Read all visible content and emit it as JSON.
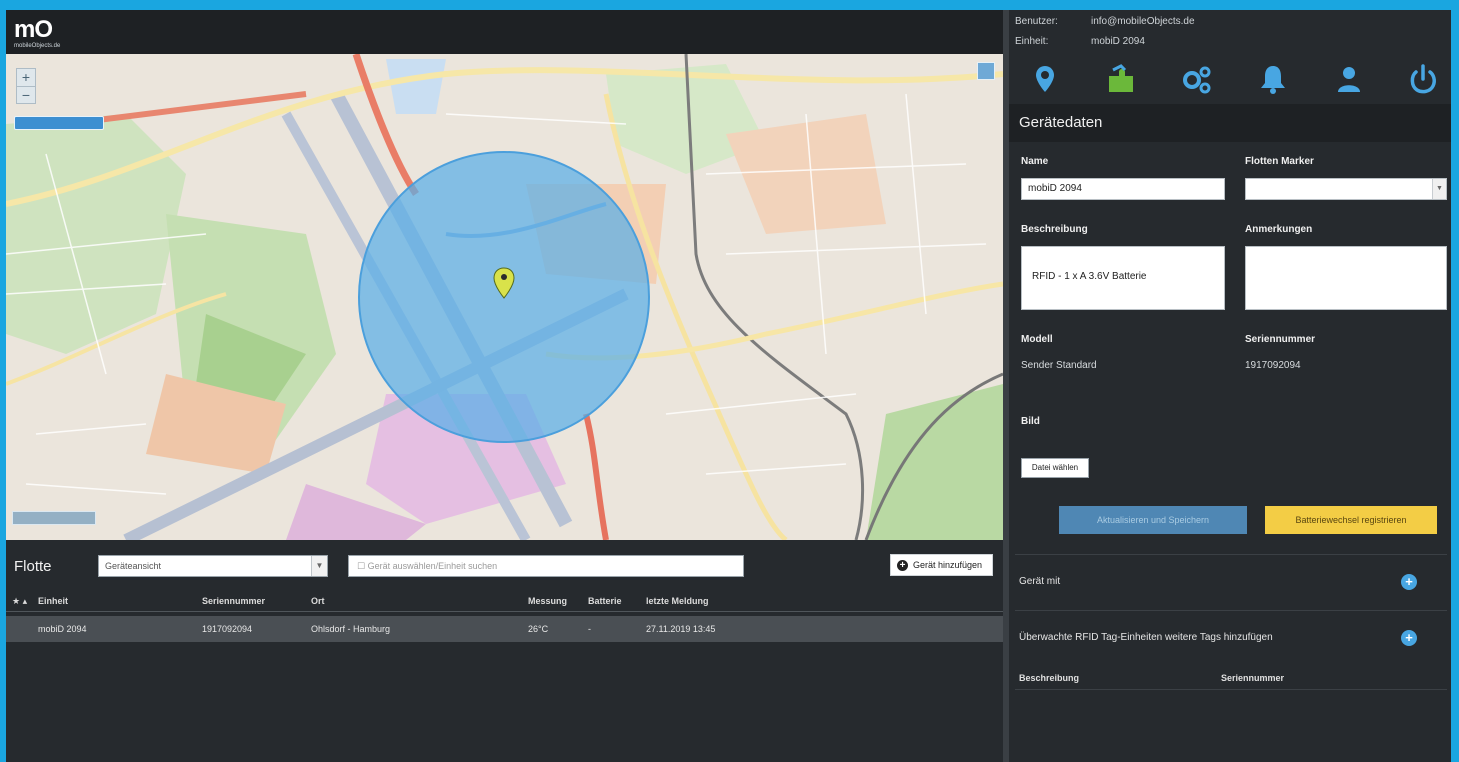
{
  "app": {
    "logo_text": "mO",
    "logo_tagline": "mobileObjects.de"
  },
  "user": {
    "benutzer_label": "Benutzer:",
    "benutzer_value": "info@mobileObjects.de",
    "einheit_label": "Einheit:",
    "einheit_value": "mobiD 2094"
  },
  "icons": [
    "map-pin-icon",
    "puzzle-icon",
    "settings-gears-icon",
    "bell-icon",
    "user-icon",
    "power-icon"
  ],
  "panel": {
    "header": "Gerätedaten",
    "name_label": "Name",
    "name_value": "mobiD 2094",
    "flotten_marker_label": "Flotten Marker",
    "flotten_marker_value": "",
    "beschreibung_label": "Beschreibung",
    "beschreibung_value": "RFID - 1 x A 3.6V Batterie",
    "anmerkungen_label": "Anmerkungen",
    "anmerkungen_value": "",
    "modell_label": "Modell",
    "modell_value": "Sender Standard",
    "seriennummer_label": "Seriennummer",
    "seriennummer_value": "1917092094",
    "bild_label": "Bild",
    "upload_button": "Datei wählen",
    "blue_button": "Aktualisieren und Speichern",
    "yellow_button": "Batteriewechsel registrieren",
    "section1": "Gerät mit",
    "section2": "Überwachte RFID Tag-Einheiten weitere Tags hinzufügen",
    "col_beschreibung": "Beschreibung",
    "col_seriennummer": "Seriennummer"
  },
  "fleet": {
    "title": "Flotte",
    "dropdown_value": "Geräteansicht",
    "search_placeholder": "Gerät auswählen/Einheit suchen",
    "add_button": "Gerät hinzufügen",
    "columns": [
      "Einheit",
      "Seriennummer",
      "Ort",
      "Messung",
      "Batterie",
      "letzte Meldung"
    ],
    "rows": [
      {
        "einheit": "mobiD 2094",
        "seriennummer": "1917092094",
        "ort": "Ohlsdorf - Hamburg",
        "messung": "26°C",
        "batterie": "-",
        "letzte_meldung": "27.11.2019 13:45"
      }
    ]
  },
  "colors": {
    "accent_blue": "#48a6e2",
    "geofence": "#5aaee8",
    "yellow": "#f3cd45",
    "panel_bg": "#262a2e"
  }
}
